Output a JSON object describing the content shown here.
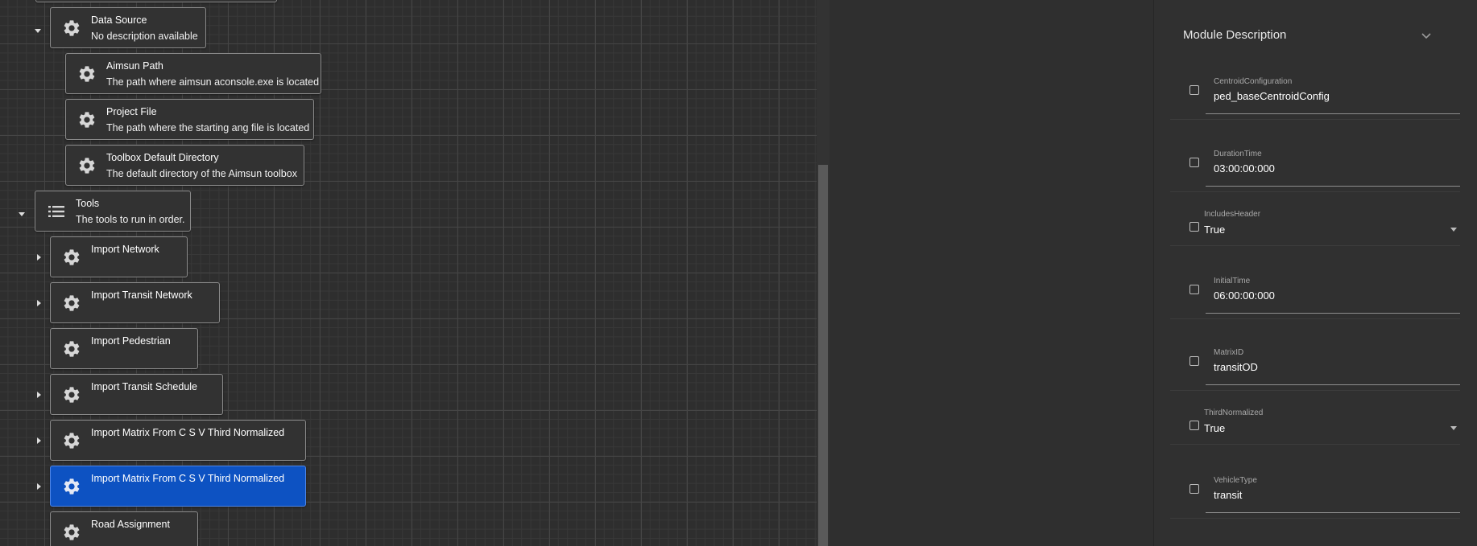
{
  "tree": {
    "data_source": {
      "name": "Data Source",
      "desc": "No description available"
    },
    "aimsun_path": {
      "name": "Aimsun Path",
      "desc": "The path where aimsun aconsole.exe is located"
    },
    "project_file": {
      "name": "Project File",
      "desc": "The path where the starting ang file is located"
    },
    "toolbox_dir": {
      "name": "Toolbox Default Directory",
      "desc": "The default directory of the Aimsun toolbox"
    },
    "tools": {
      "name": "Tools",
      "desc": "The tools to run in order."
    },
    "import_network": {
      "name": "Import Network"
    },
    "import_transit_network": {
      "name": "Import Transit Network"
    },
    "import_pedestrian": {
      "name": "Import Pedestrian"
    },
    "import_transit_schedule": {
      "name": "Import Transit Schedule"
    },
    "import_matrix_1": {
      "name": "Import Matrix From C S V Third Normalized"
    },
    "import_matrix_2": {
      "name": "Import Matrix From C S V Third Normalized"
    },
    "road_assignment": {
      "name": "Road Assignment"
    }
  },
  "icons": {
    "module": "gear-icon",
    "collection": "list-icon"
  },
  "colors": {
    "selected": "#0d52c2",
    "background": "#2f2f2f"
  },
  "panel": {
    "title": "Module Description",
    "fields": [
      {
        "label": "CentroidConfiguration",
        "value": "ped_baseCentroidConfig"
      },
      {
        "label": "DurationTime",
        "value": "03:00:00:000"
      },
      {
        "label": "IncludesHeader",
        "value": "True"
      },
      {
        "label": "InitialTime",
        "value": "06:00:00:000"
      },
      {
        "label": "MatrixID",
        "value": "transitOD"
      },
      {
        "label": "ThirdNormalized",
        "value": "True"
      },
      {
        "label": "VehicleType",
        "value": "transit"
      }
    ]
  }
}
